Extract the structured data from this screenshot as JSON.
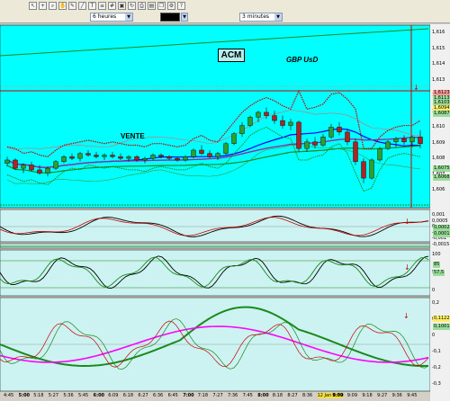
{
  "toolbar": {
    "icons": [
      "arrow-icon",
      "cross-icon",
      "zoom-icon",
      "hand-icon",
      "pencil-icon",
      "line-icon",
      "text-icon",
      "fib-icon",
      "grid-icon",
      "lock-icon",
      "refresh-icon",
      "print-icon",
      "save-icon",
      "copy-icon",
      "settings-icon",
      "help-icon"
    ],
    "period_main": "6 heures",
    "period_intraday": "3 minutes",
    "color_value": "#000000"
  },
  "annotations": {
    "acm": "ACM",
    "pair": "GBP UsD",
    "signal": "VENTE"
  },
  "colors": {
    "bg": "#00ffff",
    "panel_bg": "#ccf2f2",
    "candle_up": "#2f9e2f",
    "candle_down": "#b22222",
    "ma_blue": "#0000ee",
    "ma_purple": "#8e2f9e",
    "stop_red": "#cc0000",
    "magenta": "#ff00ff"
  },
  "price_axis": [
    "1,616",
    "1,615",
    "1,614",
    "1,613",
    "1,612",
    "1,611",
    "1,610",
    "1,609",
    "1,608",
    "1,607",
    "1,606"
  ],
  "price_tags": [
    "1,6123",
    "1,6113",
    "1,6103",
    "1,6094",
    "1,6087",
    "1,6075",
    "1,6068"
  ],
  "osc1_axis": [
    "0,001",
    "0,0005",
    "0",
    "-0,0005",
    "-0,001",
    "-0,0015"
  ],
  "osc1_tags": [
    "0,0002",
    "0,0001"
  ],
  "osc2_axis": [
    "100",
    "50",
    "0"
  ],
  "osc2_tags": [
    "85",
    "57,5"
  ],
  "osc3_axis": [
    "0,2",
    "0,1",
    "0",
    "-0,1",
    "-0,2",
    "-0,3"
  ],
  "osc3_tags": [
    "0,1122",
    "0,1001"
  ],
  "time_axis": [
    {
      "t": "4:45",
      "b": false
    },
    {
      "t": "5:00",
      "b": true
    },
    {
      "t": "5:18",
      "b": false
    },
    {
      "t": "5:27",
      "b": false
    },
    {
      "t": "5:36",
      "b": false
    },
    {
      "t": "5:45",
      "b": false
    },
    {
      "t": "6:00",
      "b": true
    },
    {
      "t": "6:09",
      "b": false
    },
    {
      "t": "6:18",
      "b": false
    },
    {
      "t": "6:27",
      "b": false
    },
    {
      "t": "6:36",
      "b": false
    },
    {
      "t": "6:45",
      "b": false
    },
    {
      "t": "7:00",
      "b": true
    },
    {
      "t": "7:18",
      "b": false
    },
    {
      "t": "7:27",
      "b": false
    },
    {
      "t": "7:36",
      "b": false
    },
    {
      "t": "7:45",
      "b": false
    },
    {
      "t": "8:00",
      "b": true
    },
    {
      "t": "8:18",
      "b": false
    },
    {
      "t": "8:27",
      "b": false
    },
    {
      "t": "8:36",
      "b": false
    },
    {
      "t": "12 Jan 8:39",
      "b": false,
      "hl": true
    },
    {
      "t": "9:00",
      "b": true
    },
    {
      "t": "9:09",
      "b": false
    },
    {
      "t": "9:18",
      "b": false
    },
    {
      "t": "9:27",
      "b": false
    },
    {
      "t": "9:36",
      "b": false
    },
    {
      "t": "9:45",
      "b": false
    }
  ],
  "candles": [
    [
      0,
      1.6079,
      1.6083,
      1.6077,
      1.6081
    ],
    [
      1,
      1.6081,
      1.6082,
      1.6075,
      1.6076
    ],
    [
      2,
      1.6076,
      1.6079,
      1.6073,
      1.6078
    ],
    [
      3,
      1.6078,
      1.608,
      1.6074,
      1.6075
    ],
    [
      4,
      1.6075,
      1.6078,
      1.6072,
      1.6073
    ],
    [
      5,
      1.6073,
      1.6077,
      1.6071,
      1.6076
    ],
    [
      6,
      1.6076,
      1.6081,
      1.6075,
      1.608
    ],
    [
      7,
      1.608,
      1.6084,
      1.6079,
      1.6083
    ],
    [
      8,
      1.6083,
      1.6085,
      1.6081,
      1.6082
    ],
    [
      9,
      1.6082,
      1.6086,
      1.608,
      1.6085
    ],
    [
      10,
      1.6085,
      1.6087,
      1.6083,
      1.6084
    ],
    [
      11,
      1.6084,
      1.6086,
      1.6082,
      1.6083
    ],
    [
      12,
      1.6083,
      1.6085,
      1.6081,
      1.6084
    ],
    [
      13,
      1.6084,
      1.6086,
      1.6082,
      1.6083
    ],
    [
      14,
      1.6083,
      1.6085,
      1.6081,
      1.6082
    ],
    [
      15,
      1.6082,
      1.6084,
      1.608,
      1.6083
    ],
    [
      16,
      1.6083,
      1.6084,
      1.608,
      1.6081
    ],
    [
      17,
      1.6081,
      1.6083,
      1.6079,
      1.6082
    ],
    [
      18,
      1.6082,
      1.6085,
      1.6081,
      1.6084
    ],
    [
      19,
      1.6084,
      1.6085,
      1.6082,
      1.6083
    ],
    [
      20,
      1.6083,
      1.6084,
      1.6081,
      1.6082
    ],
    [
      21,
      1.6082,
      1.6083,
      1.608,
      1.6081
    ],
    [
      22,
      1.6081,
      1.6084,
      1.608,
      1.6083
    ],
    [
      23,
      1.6083,
      1.6088,
      1.6082,
      1.6087
    ],
    [
      24,
      1.6087,
      1.609,
      1.6084,
      1.6085
    ],
    [
      25,
      1.6085,
      1.6087,
      1.6082,
      1.6083
    ],
    [
      26,
      1.6083,
      1.6086,
      1.6081,
      1.6085
    ],
    [
      27,
      1.6085,
      1.6092,
      1.6084,
      1.6091
    ],
    [
      28,
      1.6091,
      1.6098,
      1.609,
      1.6097
    ],
    [
      29,
      1.6097,
      1.6104,
      1.6095,
      1.6102
    ],
    [
      30,
      1.6102,
      1.6108,
      1.6101,
      1.6107
    ],
    [
      31,
      1.6107,
      1.6111,
      1.6104,
      1.611
    ],
    [
      32,
      1.611,
      1.6113,
      1.6106,
      1.6108
    ],
    [
      33,
      1.6108,
      1.6111,
      1.6103,
      1.6105
    ],
    [
      34,
      1.6105,
      1.6108,
      1.61,
      1.6102
    ],
    [
      35,
      1.6102,
      1.6106,
      1.6099,
      1.6104
    ],
    [
      36,
      1.6104,
      1.6105,
      1.6086,
      1.6088
    ],
    [
      37,
      1.6088,
      1.6094,
      1.6086,
      1.6092
    ],
    [
      38,
      1.6092,
      1.6095,
      1.6088,
      1.609
    ],
    [
      39,
      1.609,
      1.6097,
      1.6089,
      1.6095
    ],
    [
      40,
      1.6095,
      1.6103,
      1.6094,
      1.6101
    ],
    [
      41,
      1.6101,
      1.6104,
      1.6096,
      1.6098
    ],
    [
      42,
      1.6098,
      1.61,
      1.609,
      1.6092
    ],
    [
      43,
      1.6092,
      1.6094,
      1.6078,
      1.608
    ],
    [
      44,
      1.608,
      1.6082,
      1.6067,
      1.607
    ],
    [
      45,
      1.607,
      1.6082,
      1.6069,
      1.6081
    ],
    [
      46,
      1.6081,
      1.6089,
      1.608,
      1.6088
    ],
    [
      47,
      1.6088,
      1.6093,
      1.6087,
      1.6092
    ],
    [
      48,
      1.6092,
      1.6095,
      1.6089,
      1.6094
    ],
    [
      49,
      1.6094,
      1.6096,
      1.609,
      1.6092
    ],
    [
      50,
      1.6092,
      1.6096,
      1.6089,
      1.6095
    ],
    [
      51,
      1.6095,
      1.6099,
      1.6088,
      1.6091
    ]
  ]
}
